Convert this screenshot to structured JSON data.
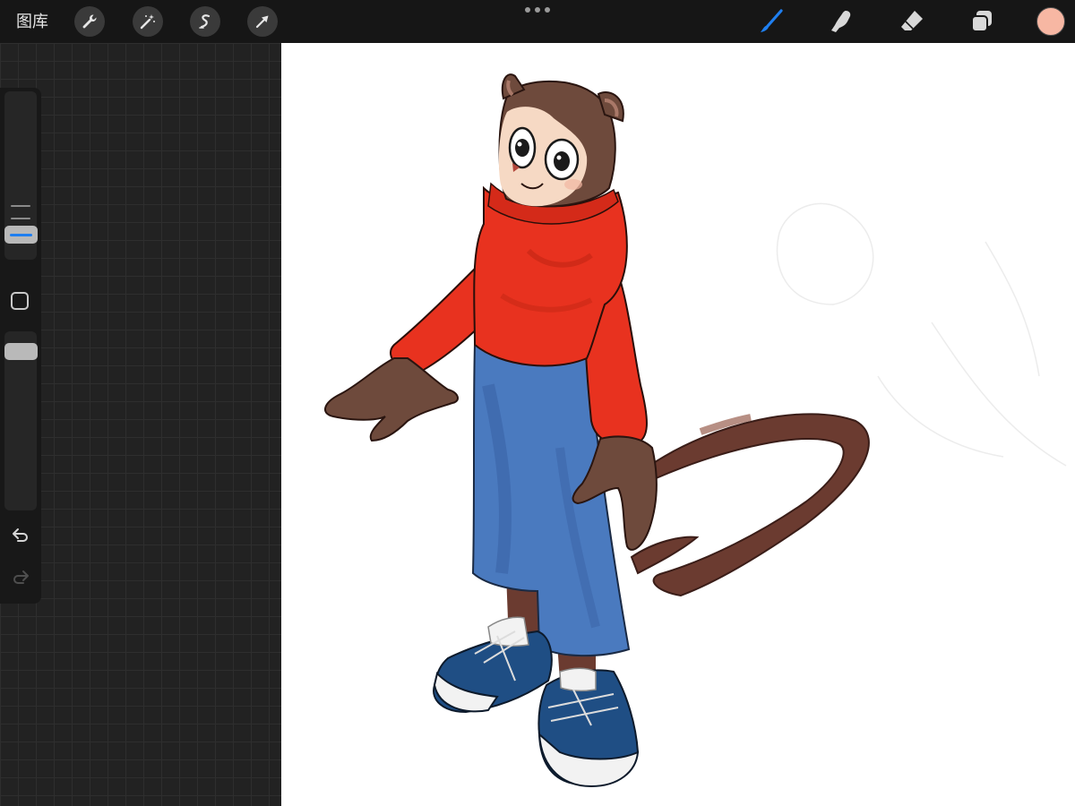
{
  "toolbar": {
    "gallery_label": "图库",
    "left_tools": [
      {
        "name": "actions",
        "icon": "wrench-icon"
      },
      {
        "name": "adjustments",
        "icon": "magic-wand-icon"
      },
      {
        "name": "selection",
        "icon": "selection-s-icon"
      },
      {
        "name": "transform",
        "icon": "arrow-cursor-icon"
      }
    ],
    "right_tools": [
      {
        "name": "brush",
        "icon": "brush-icon",
        "active": true
      },
      {
        "name": "smudge",
        "icon": "smudge-finger-icon"
      },
      {
        "name": "eraser",
        "icon": "eraser-icon"
      },
      {
        "name": "layers",
        "icon": "layers-icon"
      }
    ],
    "current_color": "#f7b7a3",
    "accent_color": "#1f7ff0",
    "more_menu_icon": "three-dots-icon"
  },
  "sidebar": {
    "brush_size_icon": "brush-size-slider",
    "modify_icon": "square-modify-icon",
    "opacity_icon": "opacity-slider",
    "undo_icon": "undo-arrow-icon",
    "redo_icon": "redo-arrow-icon",
    "redo_enabled": false
  },
  "canvas": {
    "content": "character-illustration",
    "colors": {
      "fur": "#6e4a3c",
      "face": "#f6d9c4",
      "sweater": "#e8321f",
      "jeans": "#4a7abf",
      "shoes": "#1f4e84",
      "soles": "#f2f2f2",
      "tail": "#6b3b30"
    }
  }
}
